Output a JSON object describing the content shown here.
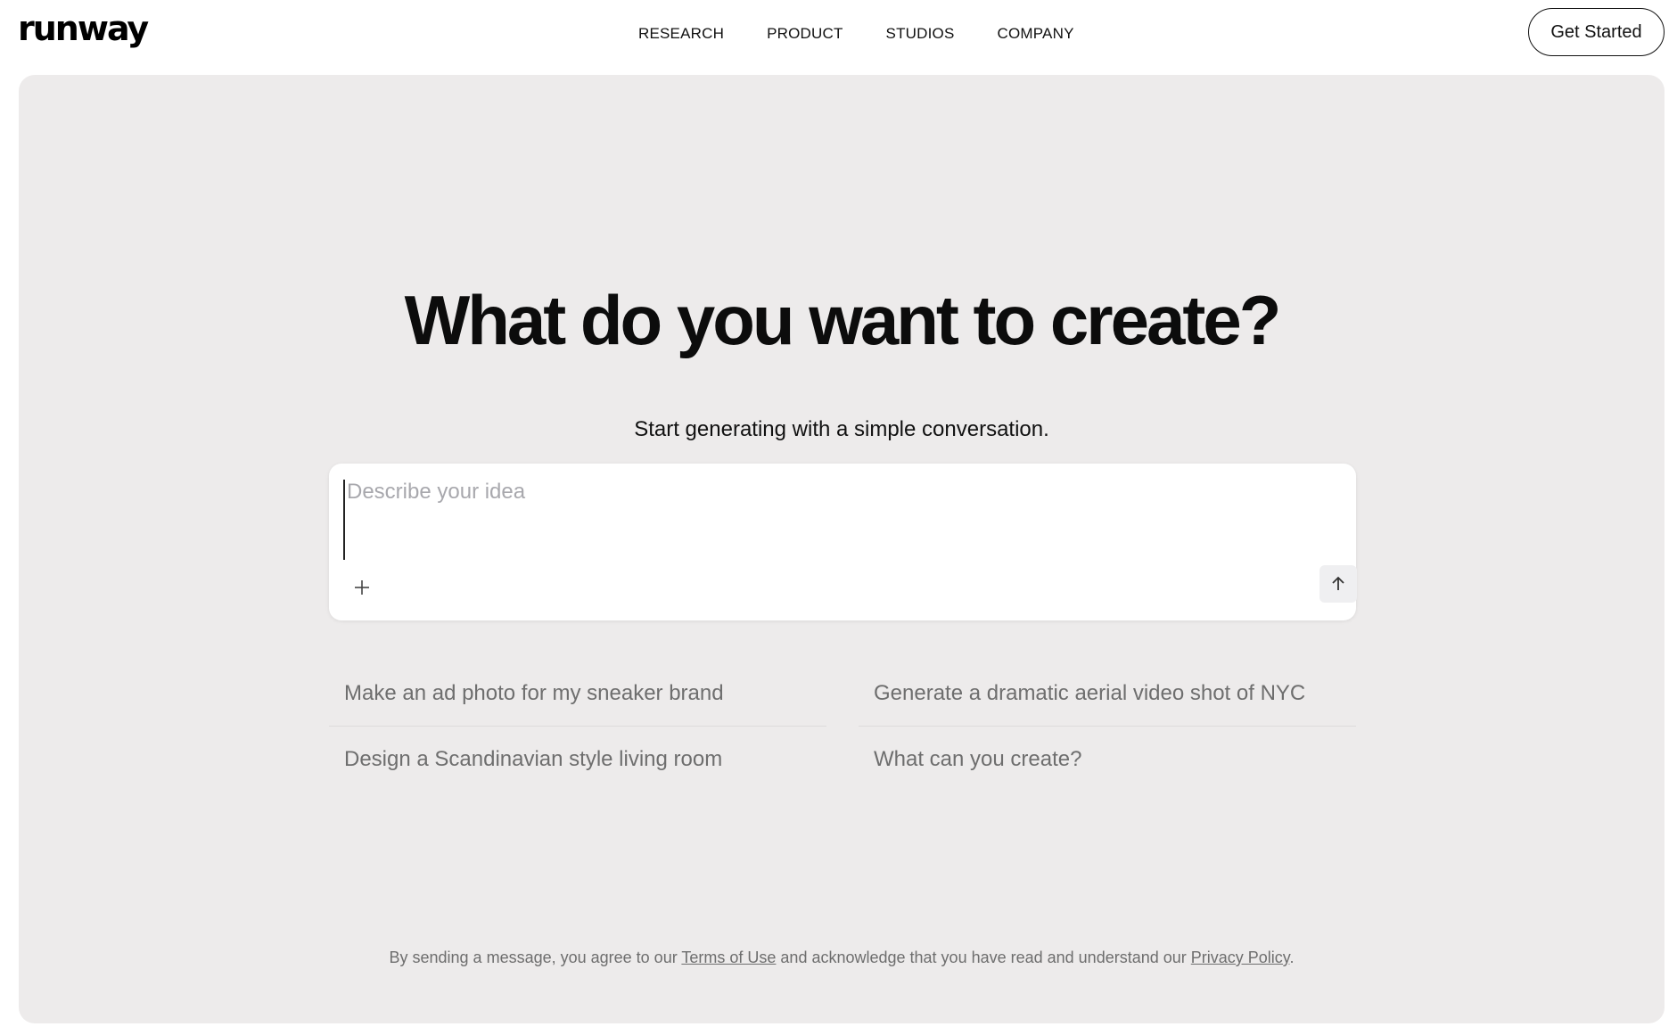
{
  "brand": {
    "logo_text": "runway"
  },
  "nav": {
    "links": [
      "RESEARCH",
      "PRODUCT",
      "STUDIOS",
      "COMPANY"
    ],
    "cta_label": "Get Started"
  },
  "hero": {
    "headline": "What do you want to create?",
    "subheadline": "Start generating with a simple conversation."
  },
  "composer": {
    "placeholder": "Describe your idea",
    "value": "",
    "attach_icon": "plus-icon",
    "send_icon": "arrow-up-icon"
  },
  "suggestions": [
    "Make an ad photo for my sneaker brand",
    "Generate a dramatic aerial video shot of NYC",
    "Design a Scandinavian style living room",
    "What can you create?"
  ],
  "legal": {
    "prefix": "By sending a message, you agree to our ",
    "terms_link": "Terms of Use",
    "middle": " and acknowledge that you have read and understand our ",
    "privacy_link": "Privacy Policy",
    "suffix": "."
  }
}
